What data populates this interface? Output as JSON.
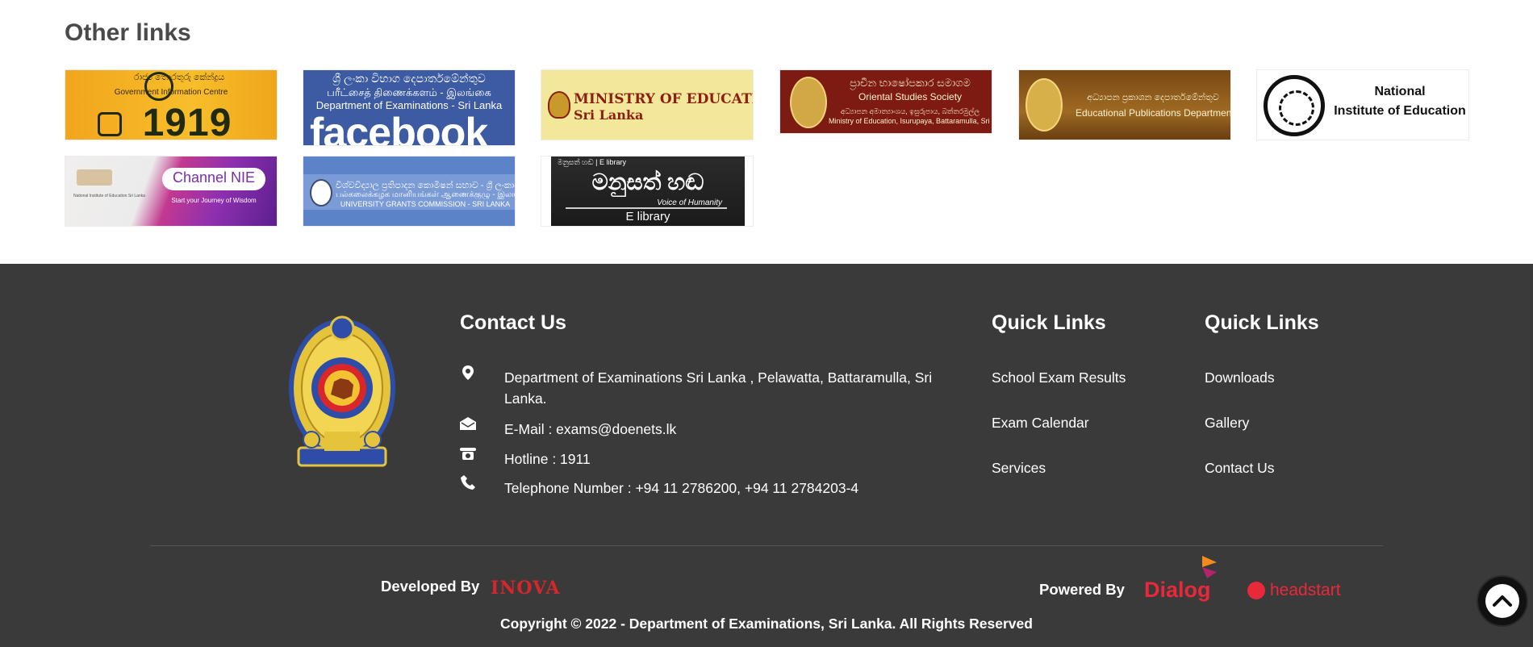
{
  "other_links": {
    "heading": "Other links",
    "tiles": {
      "t1919": {
        "line1": "රාජ්‍ය තොරතුරු කේන්ද්‍රය",
        "line2": "Government Information Centre",
        "big": "1919"
      },
      "facebook": {
        "line1": "ශ්‍රී ලංකා විභාග දෙපාර්තමේන්තුව",
        "line2": "பரீட்சைத் திணைக்களம் - இலங்கை",
        "line3": "Department of Examinations - Sri Lanka",
        "big": "facebook"
      },
      "moe": {
        "line1": "MINISTRY OF EDUCATION",
        "line2": "Sri Lanka"
      },
      "oriental": {
        "line1": "ප්‍රාචීන භාෂෝපකාර සමාගම",
        "line2": "Oriental Studies Society",
        "line3": "අධ්‍යාපන අමාත්‍යාංශය, ඉසුරුපාය, බත්තරමුල්ල",
        "line4": "Ministry of Education, Isurupaya, Battaramulla, Sri Lanka"
      },
      "pub": {
        "line1": "අධ්‍යාපන ප්‍රකාශන දෙපාර්තමේන්තුව",
        "line2": "Educational Publications Department"
      },
      "nie": {
        "line1": "National",
        "line2": "Institute of Education"
      },
      "channel": {
        "pill": "Channel NIE",
        "tag": "Start your Journey of Wisdom",
        "small": "National Institute of Education Sri Lanka"
      },
      "ugc": {
        "line1": "විශ්වවිද්‍යාල ප්‍රතිපාදන කොමිෂන් සභාව - ශ්‍රී ලංකාව",
        "line2": "பல்கலைக்கழக மானியங்கள் ஆணைக்குழு - இலங்கை",
        "line3": "UNIVERSITY GRANTS COMMISSION - SRI LANKA"
      },
      "elib": {
        "line1": "මනුසත් හඬ | E library",
        "big": "මනුසත් හඬ",
        "line2": "Voice of Humanity",
        "line3": "E library"
      }
    }
  },
  "footer": {
    "contact": {
      "title": "Contact Us",
      "address": "Department of Examinations Sri Lanka , Pelawatta, Battaramulla, Sri Lanka.",
      "email": "E-Mail : exams@doenets.lk",
      "hotline": "Hotline : 1911",
      "telephone": "Telephone Number : +94 11 2786200, +94 11 2784203-4"
    },
    "quick_links_1": {
      "title": "Quick Links",
      "items": [
        "School Exam Results",
        "Exam Calendar",
        "Services"
      ]
    },
    "quick_links_2": {
      "title": "Quick Links",
      "items": [
        "Downloads",
        "Gallery",
        "Contact Us"
      ]
    },
    "developed_by": "Developed By",
    "developer": "INOVA",
    "powered_by": "Powered By",
    "sponsor1": "Dialog",
    "sponsor2": "headstart",
    "copyright": "Copyright © 2022 - Department of Examinations, Sri Lanka. All Rights Reserved"
  },
  "colors": {
    "footer_bg": "#3a3a3a",
    "heading": "#4a4a4a",
    "brand_red": "#e8293a"
  },
  "icons": {
    "address": "map-pin-icon",
    "email": "envelope-icon",
    "hotline": "telephone-icon",
    "telephone": "phone-icon",
    "scroll_top": "chevron-up-icon"
  }
}
